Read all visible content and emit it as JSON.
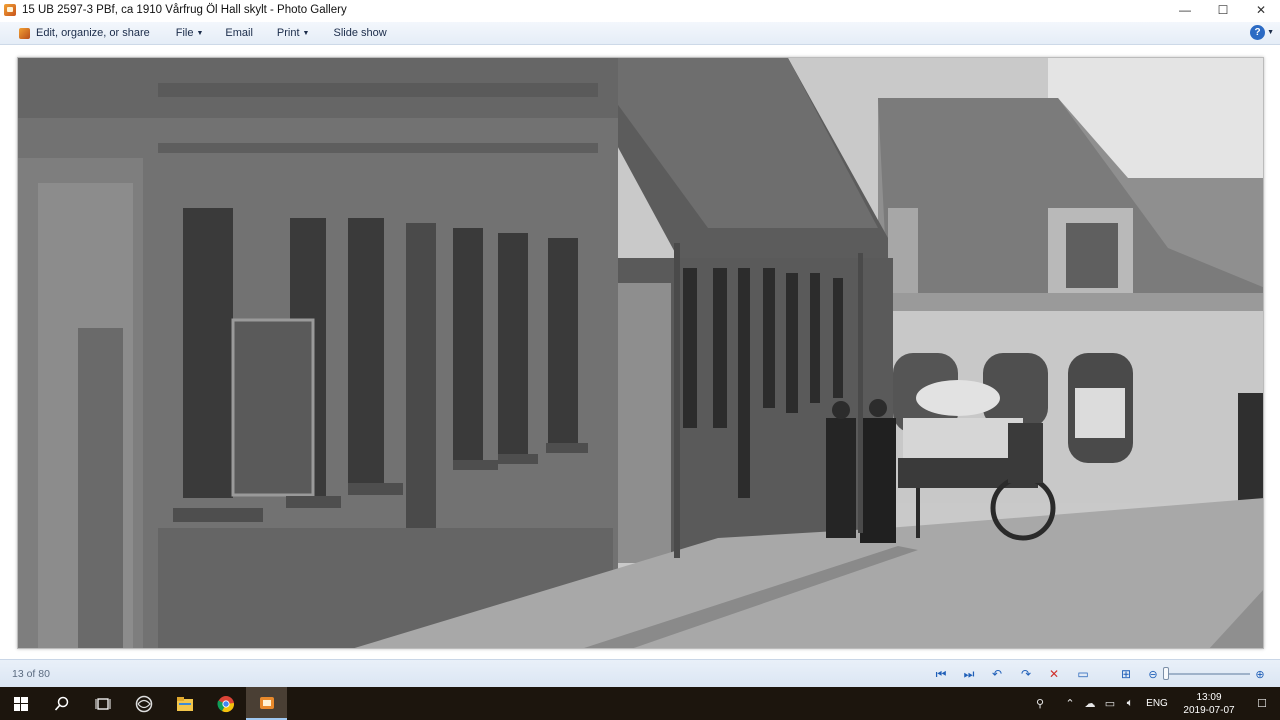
{
  "window": {
    "title": "15  UB 2597-3 PBf, ca 1910 Vårfrug Öl Hall skylt - Photo Gallery",
    "controls": {
      "minimize": "—",
      "maximize": "☐",
      "close": "✕"
    }
  },
  "toolbar": {
    "organize_label": "Edit, organize, or share",
    "file_label": "File",
    "email_label": "Email",
    "print_label": "Print",
    "slideshow_label": "Slide show",
    "help_label": "?"
  },
  "status": {
    "counter": "13 of 80"
  },
  "controls": {
    "icons": [
      "previous-icon",
      "next-icon",
      "rotate-left-icon",
      "rotate-right-icon",
      "delete-icon",
      "slideshow-icon",
      "fit-icon",
      "zoom-out-icon",
      "zoom-in-icon"
    ],
    "delete_color": "#d0312d",
    "accent_color": "#1f5fb8"
  },
  "taskbar": {
    "apps": [
      "start-icon",
      "search-icon",
      "task-view-icon",
      "app-globe-icon",
      "file-explorer-icon",
      "chrome-icon",
      "photo-gallery-icon"
    ],
    "language": "ENG",
    "time": "13:09",
    "date": "2019-07-07"
  }
}
